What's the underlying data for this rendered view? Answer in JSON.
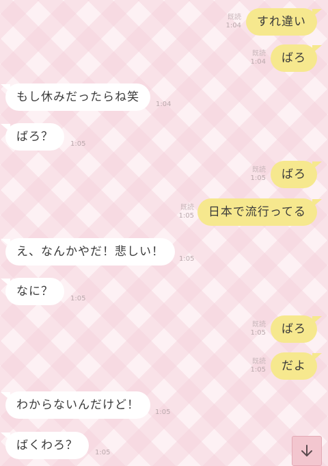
{
  "messages": [
    {
      "dir": "out",
      "text": "すれ違い",
      "read": "既読",
      "time": "1:04"
    },
    {
      "dir": "out",
      "text": "ばろ",
      "read": "既読",
      "time": "1:04"
    },
    {
      "dir": "in",
      "text": "もし休みだったらね笑",
      "time": "1:04"
    },
    {
      "dir": "in",
      "text": "ばろ？",
      "time": "1:05"
    },
    {
      "dir": "out",
      "text": "ばろ",
      "read": "既読",
      "time": "1:05"
    },
    {
      "dir": "out",
      "text": "日本で流行ってる",
      "read": "既読",
      "time": "1:05"
    },
    {
      "dir": "in",
      "text": "え、なんかやだ！悲しい！",
      "time": "1:05"
    },
    {
      "dir": "in",
      "text": "なに？",
      "time": "1:05"
    },
    {
      "dir": "out",
      "text": "ばろ",
      "read": "既読",
      "time": "1:05"
    },
    {
      "dir": "out",
      "text": "だよ",
      "read": "既読",
      "time": "1:05"
    },
    {
      "dir": "in",
      "text": "わからないんだけど！",
      "time": "1:05"
    },
    {
      "dir": "in",
      "text": "ばくわろ？",
      "time": "1:05"
    }
  ],
  "scroll_button": {
    "icon": "arrow-down-icon"
  },
  "colors": {
    "outgoing_bubble": "#f6e88e",
    "incoming_bubble": "#ffffff",
    "background": "#fdf1f4",
    "scroll_button": "#f3c6cf"
  }
}
